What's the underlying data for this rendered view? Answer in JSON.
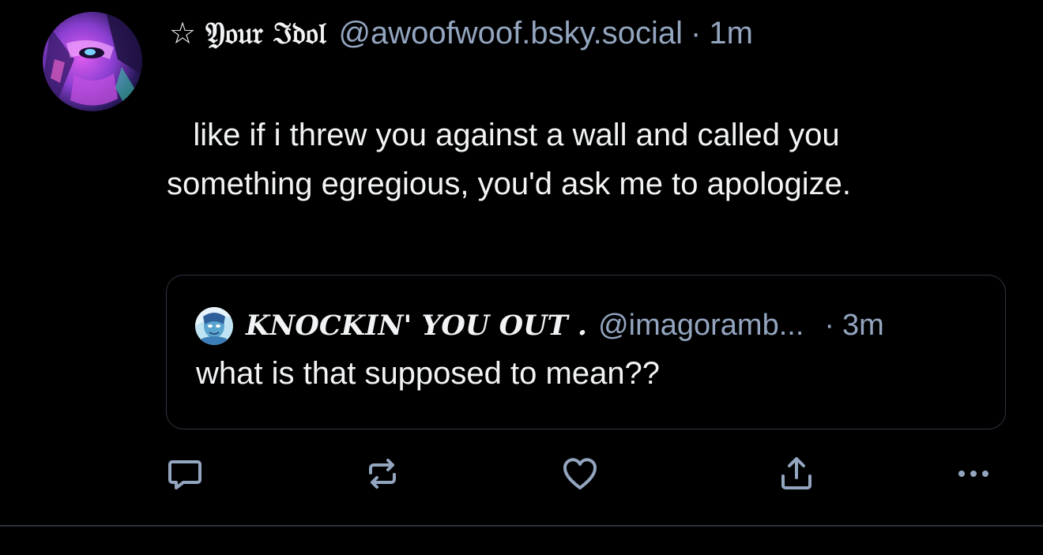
{
  "post": {
    "star_glyph": "☆",
    "display_name": "𝔜𝔬𝔲𝔯 ℑ𝔡𝔬𝔩",
    "handle": "@awoofwoof.bsky.social",
    "separator": "·",
    "timestamp": "1m",
    "text": "   like if i threw you against a wall and called you\nsomething egregious, you'd ask me to apologize.",
    "avatar_icon": "user-avatar-icon"
  },
  "quote": {
    "display_name": "KNOCKIN' YOU OUT .",
    "handle": "@imagoramb...",
    "separator": "·",
    "timestamp": "3m",
    "text": "what is that supposed to mean??",
    "avatar_icon": "quoted-user-avatar-icon"
  },
  "actions": {
    "reply_icon": "reply-icon",
    "repost_icon": "repost-icon",
    "like_icon": "heart-icon",
    "share_icon": "share-icon",
    "more_icon": "more-icon"
  },
  "colors": {
    "background": "#000000",
    "text_primary": "#f1f3f5",
    "text_secondary": "#93a5bf",
    "border": "#2e3440"
  }
}
